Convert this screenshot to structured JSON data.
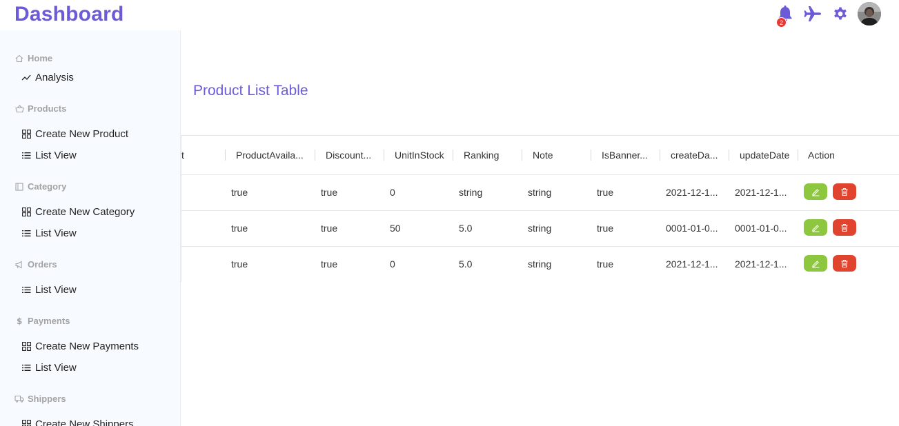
{
  "header": {
    "title": "Dashboard",
    "notification_count": "2",
    "icons": [
      "bell-icon",
      "plane-icon",
      "gear-icon",
      "avatar"
    ]
  },
  "sidebar": {
    "sections": [
      {
        "label": "Home",
        "icon": "home-icon",
        "items": [
          {
            "label": "Analysis",
            "icon": "chart-line-icon"
          }
        ]
      },
      {
        "label": "Products",
        "icon": "basket-icon",
        "items": [
          {
            "label": "Create New Product",
            "icon": "grid-icon"
          },
          {
            "label": "List View",
            "icon": "list-icon"
          }
        ]
      },
      {
        "label": "Category",
        "icon": "square-icon",
        "items": [
          {
            "label": "Create New Category",
            "icon": "grid-icon"
          },
          {
            "label": "List View",
            "icon": "list-icon"
          }
        ]
      },
      {
        "label": "Orders",
        "icon": "megaphone-icon",
        "items": [
          {
            "label": "List View",
            "icon": "list-icon"
          }
        ]
      },
      {
        "label": "Payments",
        "icon": "dollar-icon",
        "items": [
          {
            "label": "Create New Payments",
            "icon": "grid-icon"
          },
          {
            "label": "List View",
            "icon": "list-icon"
          }
        ]
      },
      {
        "label": "Shippers",
        "icon": "truck-icon",
        "items": [
          {
            "label": "Create New Shippers",
            "icon": "grid-icon"
          }
        ]
      }
    ]
  },
  "main": {
    "title": "Product List Table",
    "table": {
      "columns": [
        "t",
        "ProductAvaila...",
        "Discount...",
        "UnitInStock",
        "Ranking",
        "Note",
        "IsBanner...",
        "createDa...",
        "updateDate",
        "Action"
      ],
      "rows": [
        [
          "true",
          "true",
          "0",
          "string",
          "string",
          "true",
          "2021-12-1...",
          "2021-12-1..."
        ],
        [
          "true",
          "true",
          "50",
          "5.0",
          "string",
          "true",
          "0001-01-0...",
          "0001-01-0..."
        ],
        [
          "true",
          "true",
          "0",
          "5.0",
          "string",
          "true",
          "2021-12-1...",
          "2021-12-1..."
        ]
      ]
    }
  },
  "colors": {
    "accent": "#6b5bd6",
    "edit_button": "#8dc63f",
    "delete_button": "#e0442e",
    "badge": "#e53935",
    "sidebar_bg": "#f7fbff"
  }
}
